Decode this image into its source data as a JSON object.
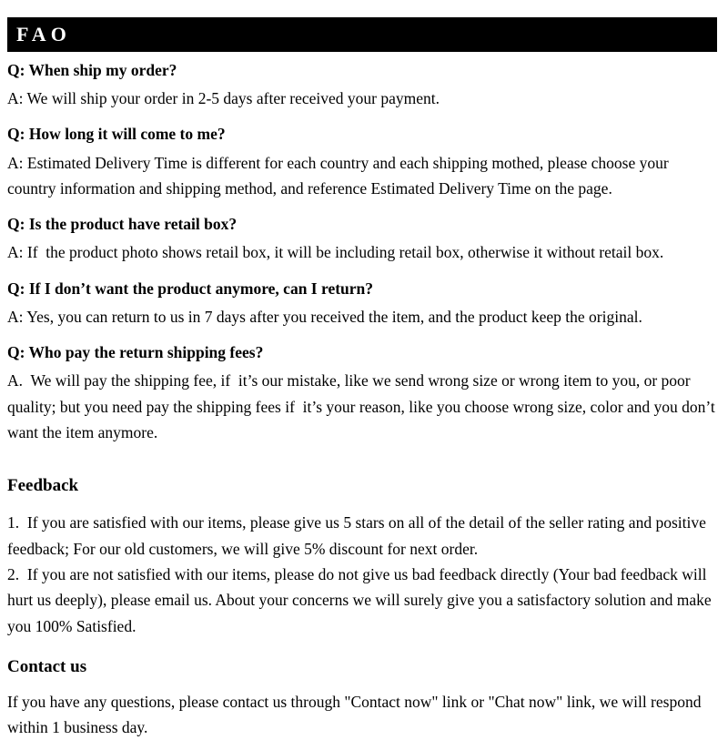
{
  "header": {
    "title": "FAO",
    "bar_color": "#000000",
    "text_color": "#ffffff"
  },
  "faq": {
    "items": [
      {
        "question": "Q: When ship my order?",
        "answer": "A: We will ship your order in 2-5 days after received your payment."
      },
      {
        "question": "Q: How long it will come to me?",
        "answer": "A: Estimated Delivery Time is different for each country and each shipping mothed, please choose your country information and shipping method, and reference Estimated Delivery Time on the page."
      },
      {
        "question": "Q: Is the product have retail box?",
        "answer": "A: If  the product photo shows retail box, it will be including retail box, otherwise it without retail box."
      },
      {
        "question": "Q: If I don’t want the product anymore, can I return?",
        "answer": "A: Yes, you can return to us in 7 days after you received the item, and the product keep the original."
      },
      {
        "question": "Q: Who pay the return shipping fees?",
        "answer": "A.  We will pay the shipping fee, if  it’s our mistake, like we send wrong size or wrong item to you, or poor quality; but you need pay the shipping fees if  it’s your reason, like you choose wrong size, color and you don’t want the item anymore."
      }
    ]
  },
  "feedback": {
    "heading": "Feedback",
    "items": [
      "1.  If you are satisfied with our items, please give us 5 stars on all of the detail of the seller rating and positive feedback; For our old customers, we will give 5% discount for next order.",
      "2.  If you are not satisfied with our items, please do not give us bad feedback directly (Your bad feedback will hurt us deeply), please email us. About your concerns we will surely give you a satisfactory solution and make you 100% Satisfied."
    ]
  },
  "contact": {
    "heading": "Contact us",
    "body": "If you have any questions, please contact us through \"Contact now\" link or \"Chat now\" link, we will respond within 1 business day."
  }
}
